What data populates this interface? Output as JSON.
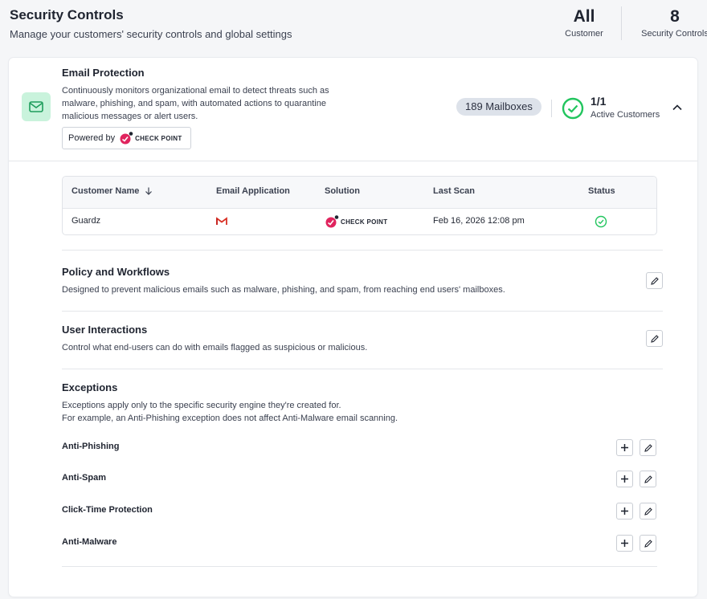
{
  "header": {
    "title": "Security Controls",
    "subtitle": "Manage your customers' security controls and global settings",
    "stats": [
      {
        "value": "All",
        "label": "Customer"
      },
      {
        "value": "8",
        "label": "Security Controls"
      }
    ]
  },
  "product": {
    "icon": "mail-icon",
    "title": "Email Protection",
    "description": "Continuously monitors organizational email to detect threats such as malware, phishing, and spam, with automated actions to quarantine malicious messages or alert users.",
    "powered_by_label": "Powered by",
    "vendor": "CHECK POINT",
    "mailboxes": "189 Mailboxes",
    "active_count": "1/1",
    "active_label": "Active Customers"
  },
  "table": {
    "columns": [
      "Customer Name",
      "Email Application",
      "Solution",
      "Last Scan",
      "Status"
    ],
    "rows": [
      {
        "customer": "Guardz",
        "app_icon": "gmail-icon",
        "solution": "CHECK POINT",
        "last_scan": "Feb 16, 2026 12:08 pm",
        "status_icon": "check-circle-icon"
      }
    ]
  },
  "policy": {
    "title": "Policy and Workflows",
    "description": "Designed to prevent malicious emails such as malware, phishing, and spam, from reaching end users' mailboxes."
  },
  "interactions": {
    "title": "User Interactions",
    "description": "Control what end-users can do with emails flagged as suspicious or malicious."
  },
  "exceptions": {
    "title": "Exceptions",
    "description_line1": "Exceptions apply only to the specific security engine they're created for.",
    "description_line2": "For example, an Anti-Phishing exception does not affect Anti-Malware email scanning.",
    "items": [
      "Anti-Phishing",
      "Anti-Spam",
      "Click-Time Protection",
      "Anti-Malware"
    ]
  },
  "colors": {
    "accent_green": "#22c55e",
    "mail_badge_bg": "#c9f3dc",
    "checkpoint_red": "#e0245e",
    "gmail_red": "#d93025"
  }
}
